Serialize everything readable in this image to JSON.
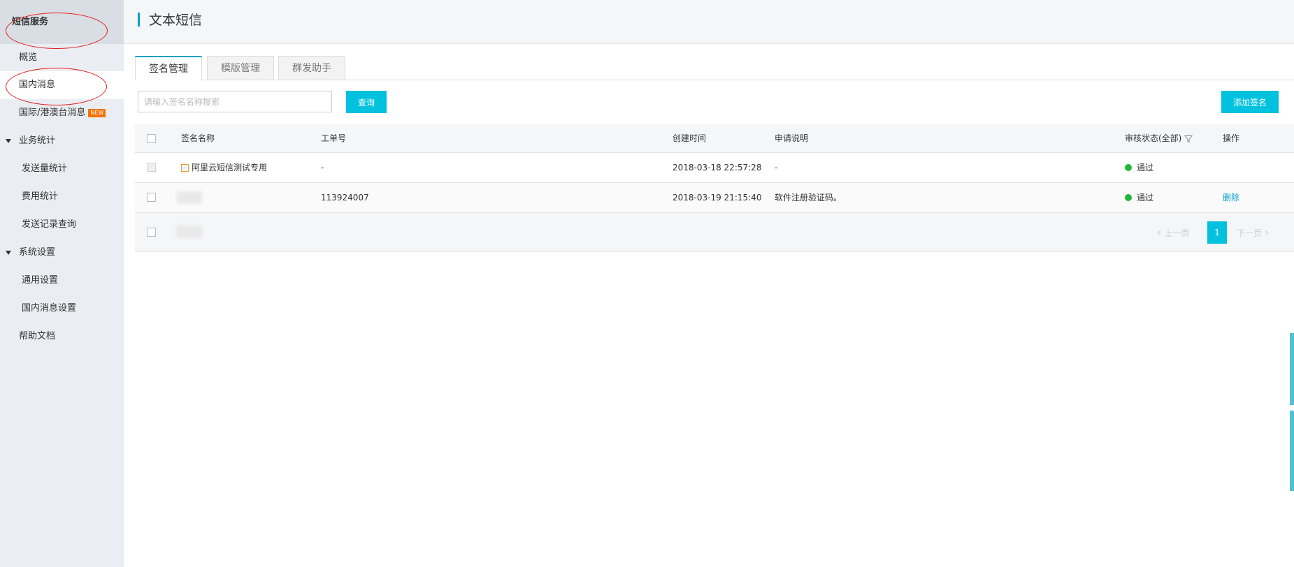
{
  "sidebar": {
    "title": "短信服务",
    "items": [
      {
        "label": "概览"
      },
      {
        "label": "国内消息"
      },
      {
        "label": "国际/港澳台消息",
        "badge": "NEW"
      },
      {
        "label": "业务统计"
      },
      {
        "label": "发送量统计"
      },
      {
        "label": "费用统计"
      },
      {
        "label": "发送记录查询"
      },
      {
        "label": "系统设置"
      },
      {
        "label": "通用设置"
      },
      {
        "label": "国内消息设置"
      },
      {
        "label": "帮助文档"
      }
    ]
  },
  "header": {
    "title": "文本短信"
  },
  "tabs": [
    {
      "label": "签名管理",
      "active": true
    },
    {
      "label": "模版管理",
      "active": false
    },
    {
      "label": "群发助手",
      "active": false
    }
  ],
  "toolbar": {
    "search_placeholder": "请输入签名名称搜索",
    "query_label": "查询",
    "add_label": "添加签名"
  },
  "table": {
    "columns": [
      "签名名称",
      "工单号",
      "创建时间",
      "申请说明",
      "审核状态(全部)",
      "操作"
    ],
    "rows": [
      {
        "name": "阿里云短信测试专用",
        "ticket": "-",
        "created": "2018-03-18 22:57:28",
        "desc": "-",
        "status": "通过",
        "action": ""
      },
      {
        "name": "",
        "ticket": "113924007",
        "created": "2018-03-19 21:15:40",
        "desc": "软件注册验证码。",
        "status": "通过",
        "action": "删除"
      }
    ]
  },
  "pagination": {
    "prev": "上一页",
    "current": "1",
    "next": "下一页"
  },
  "colors": {
    "accent": "#00c1de",
    "link": "#00a2ca",
    "status_ok": "#1eb738",
    "badge": "#f57100",
    "annotation": "#e02020"
  }
}
